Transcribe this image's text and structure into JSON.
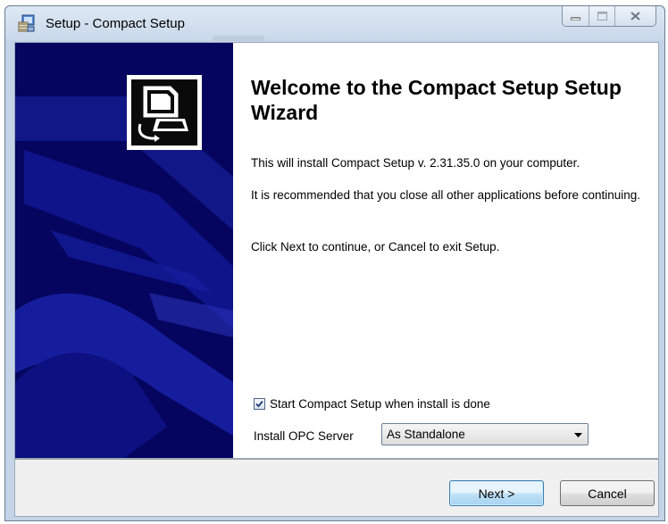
{
  "window": {
    "title": "Setup - Compact Setup",
    "icons": {
      "app": "setup-app-icon",
      "minimize": "minimize-icon",
      "maximize": "maximize-icon",
      "close": "close-icon"
    }
  },
  "wizard": {
    "logo_icon": "computer-setup-icon",
    "heading": "Welcome to the Compact Setup Setup Wizard",
    "install_text": "This will install Compact Setup v. 2.31.35.0 on your computer.",
    "recommend_text": "It is recommended that you close all other applications before continuing.",
    "continue_text": "Click Next to continue, or Cancel to exit Setup.",
    "start_checkbox": {
      "label": "Start Compact Setup when install is done",
      "checked": true
    },
    "opc": {
      "label": "Install OPC Server",
      "selected": "As Standalone"
    }
  },
  "buttons": {
    "next": "Next >",
    "cancel": "Cancel"
  },
  "colors": {
    "side_panel": "#05055f",
    "side_panel_accent": "#1a22a8",
    "title_bar": "#c9d8ea"
  }
}
